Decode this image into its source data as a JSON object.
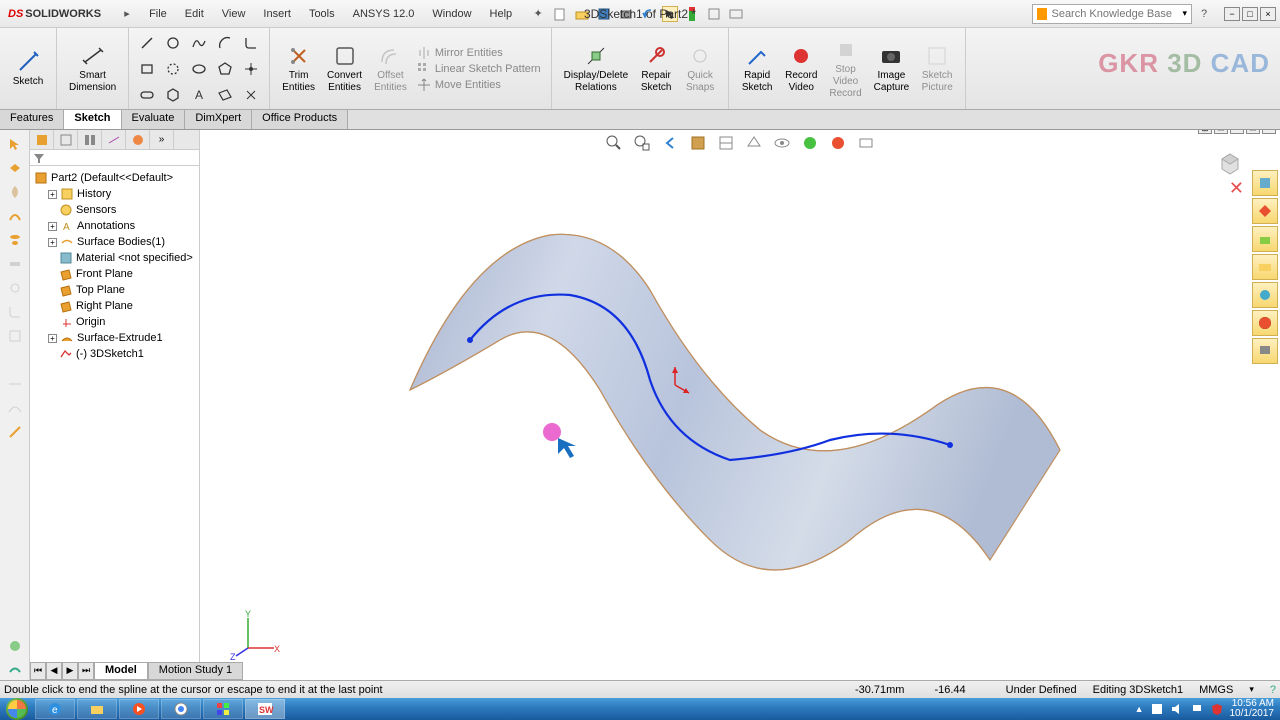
{
  "app": {
    "name": "SOLIDWORKS",
    "doc_title": "3DSketch1 of Part2 *"
  },
  "menu": [
    "File",
    "Edit",
    "View",
    "Insert",
    "Tools",
    "ANSYS 12.0",
    "Window",
    "Help"
  ],
  "search": {
    "placeholder": "Search Knowledge Base"
  },
  "ribbon": {
    "sketch_btn": "Sketch",
    "smart_dim": "Smart\nDimension",
    "trim": "Trim\nEntities",
    "convert": "Convert\nEntities",
    "offset": "Offset\nEntities",
    "mirror": "Mirror Entities",
    "linear": "Linear Sketch Pattern",
    "move": "Move Entities",
    "display_rel": "Display/Delete\nRelations",
    "repair": "Repair\nSketch",
    "quick": "Quick\nSnaps",
    "rapid": "Rapid\nSketch",
    "record": "Record\nVideo",
    "stop": "Stop\nVideo\nRecord",
    "image": "Image\nCapture",
    "picture": "Sketch\nPicture"
  },
  "cmd_tabs": [
    "Features",
    "Sketch",
    "Evaluate",
    "DimXpert",
    "Office Products"
  ],
  "cmd_tab_active": 1,
  "tree": {
    "root": "Part2  (Default<<Default>",
    "items": [
      "History",
      "Sensors",
      "Annotations",
      "Surface Bodies(1)",
      "Material <not specified>",
      "Front Plane",
      "Top Plane",
      "Right Plane",
      "Origin",
      "Surface-Extrude1",
      "(-) 3DSketch1"
    ]
  },
  "bottom_tabs": [
    "Model",
    "Motion Study 1"
  ],
  "status": {
    "msg": "Double click to end the spline at the cursor or escape to end it at the last point",
    "x": "-30.71mm",
    "y": "-16.44",
    "defined": "Under Defined",
    "editing": "Editing 3DSketch1",
    "units": "MMGS"
  },
  "brand": {
    "p1": "GKR ",
    "p2": "3D ",
    "p3": "CAD"
  },
  "clock": {
    "time": "10:56 AM",
    "date": "10/1/2017"
  }
}
